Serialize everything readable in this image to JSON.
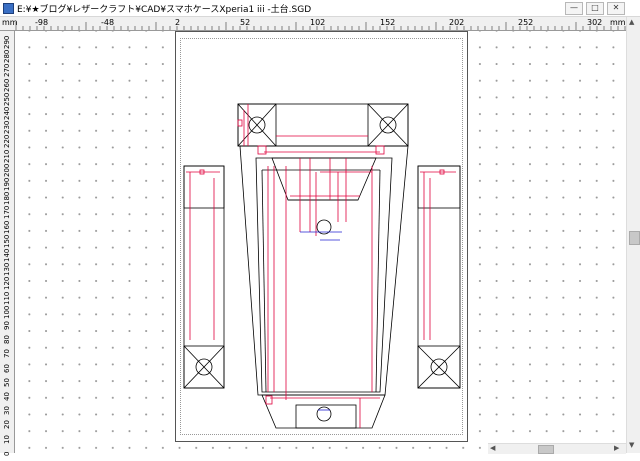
{
  "window": {
    "title": "E:¥★ブログ¥レザークラフト¥CAD¥スマホケースXperia1 iii -土台.SGD",
    "minimize_glyph": "—",
    "maximize_glyph": "□",
    "close_glyph": "✕"
  },
  "ruler": {
    "unit_left": "mm",
    "unit_right": "mm",
    "top_labels": [
      "-98",
      "-48",
      "2",
      "52",
      "102",
      "152",
      "202",
      "252",
      "302"
    ],
    "left_labels": [
      "290",
      "280",
      "270",
      "260",
      "250",
      "240",
      "230",
      "220",
      "210",
      "200",
      "190",
      "180",
      "170",
      "160",
      "150",
      "140",
      "130",
      "120",
      "110",
      "100",
      "90",
      "80",
      "70",
      "60",
      "50",
      "40",
      "30",
      "20",
      "10",
      "0"
    ]
  },
  "scrollbar": {
    "up_arrow": "▲",
    "down_arrow": "▼",
    "left_arrow": "◀",
    "right_arrow": "▶"
  },
  "colors": {
    "outline": "#000000",
    "dimension": "#e0003c",
    "center_mark": "#2020d0",
    "grid_dot": "#9a9a9a"
  }
}
